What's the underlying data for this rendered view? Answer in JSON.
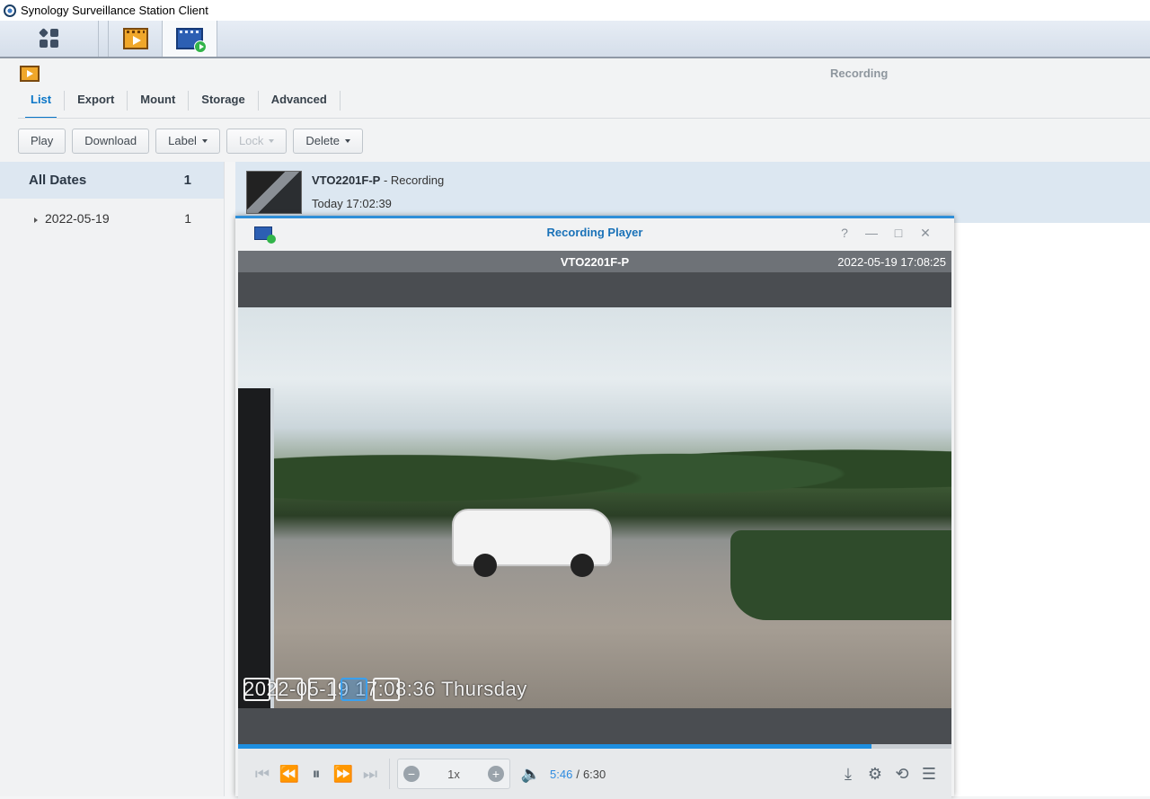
{
  "os_window": {
    "title": "Synology Surveillance Station Client"
  },
  "launcher": {
    "items": [
      {
        "name": "main-menu",
        "icon": "grid-icon"
      },
      {
        "name": "recording",
        "icon": "film-icon"
      },
      {
        "name": "recording-player",
        "icon": "player-icon"
      }
    ]
  },
  "header": {
    "module_title": "Recording",
    "tabs": [
      "List",
      "Export",
      "Mount",
      "Storage",
      "Advanced"
    ],
    "active_tab": "List"
  },
  "toolbar": {
    "play": "Play",
    "download": "Download",
    "label": "Label",
    "lock": "Lock",
    "delete": "Delete"
  },
  "datepane": {
    "all_label": "All Dates",
    "all_count": "1",
    "dates": [
      {
        "label": "2022-05-19",
        "count": "1"
      }
    ]
  },
  "recordings": [
    {
      "camera": "VTO2201F-P",
      "suffix": " - Recording",
      "time": "Today 17:02:39"
    }
  ],
  "player": {
    "title": "Recording Player",
    "window_controls": {
      "help": "?",
      "minimize": "—",
      "maximize": "□",
      "close": "✕"
    },
    "camera": "VTO2201F-P",
    "timestamp": "2022-05-19 17:08:25",
    "osd_text": "2022-05-19 17:08:36 Thursday",
    "speed": "1x",
    "time_current": "5:46",
    "time_separator": "/",
    "time_total": "6:30",
    "progress_fraction": 0.888
  },
  "colors": {
    "accent": "#1e8fe0",
    "selection": "#dce7f1",
    "brand_blue": "#1a72b8"
  }
}
